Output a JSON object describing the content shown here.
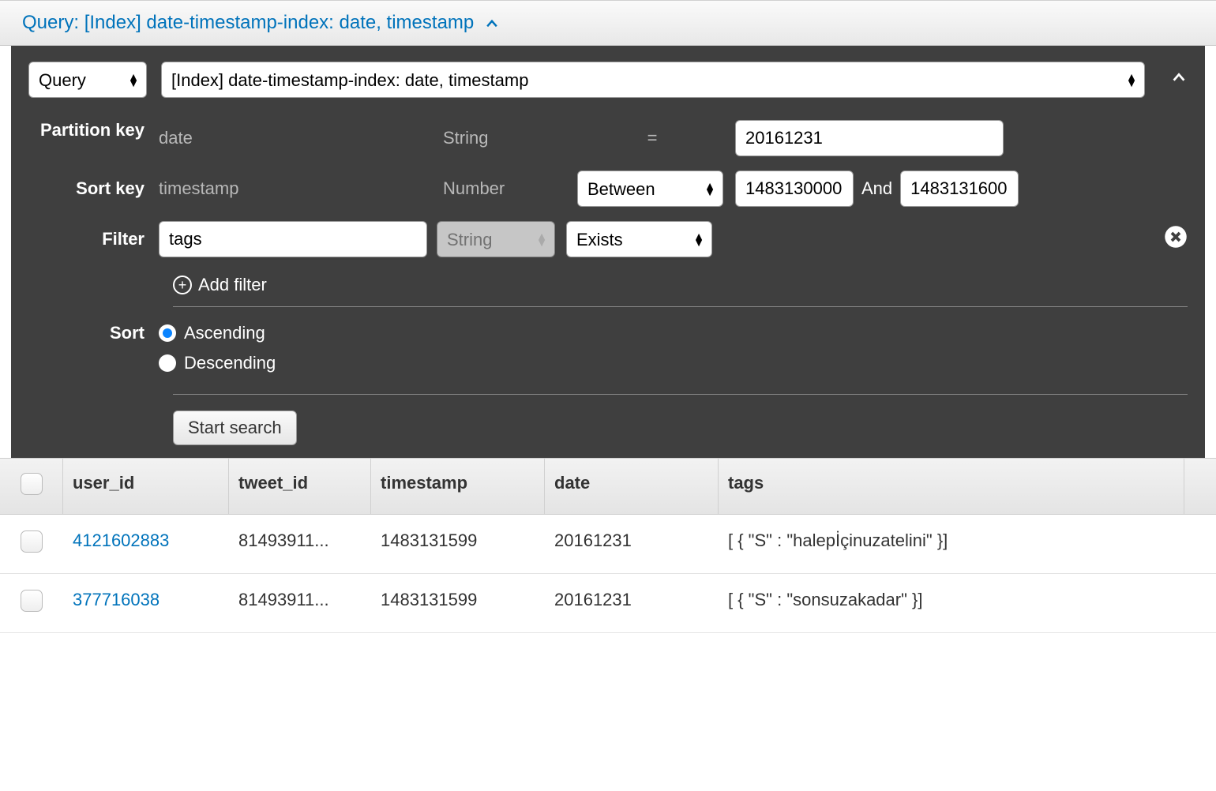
{
  "header": {
    "title": "Query: [Index] date-timestamp-index: date, timestamp"
  },
  "topSelects": {
    "mode": "Query",
    "index": "[Index] date-timestamp-index: date, timestamp"
  },
  "partitionKey": {
    "label": "Partition key",
    "name": "date",
    "type": "String",
    "op": "=",
    "value": "20161231"
  },
  "sortKey": {
    "label": "Sort key",
    "name": "timestamp",
    "type": "Number",
    "op": "Between",
    "from": "1483130000",
    "and": "And",
    "to": "1483131600"
  },
  "filter": {
    "label": "Filter",
    "attr": "tags",
    "type": "String",
    "op": "Exists",
    "addLabel": "Add filter"
  },
  "sort": {
    "label": "Sort",
    "asc": "Ascending",
    "desc": "Descending",
    "selected": "asc"
  },
  "actions": {
    "start": "Start search"
  },
  "table": {
    "headers": [
      "user_id",
      "tweet_id",
      "timestamp",
      "date",
      "tags"
    ],
    "rows": [
      {
        "user_id": "4121602883",
        "tweet_id": "81493911...",
        "timestamp": "1483131599",
        "date": "20161231",
        "tags": "[ { \"S\" : \"halepİçinuzatelini\" }]"
      },
      {
        "user_id": "377716038",
        "tweet_id": "81493911...",
        "timestamp": "1483131599",
        "date": "20161231",
        "tags": "[ { \"S\" : \"sonsuzakadar\" }]"
      }
    ]
  }
}
